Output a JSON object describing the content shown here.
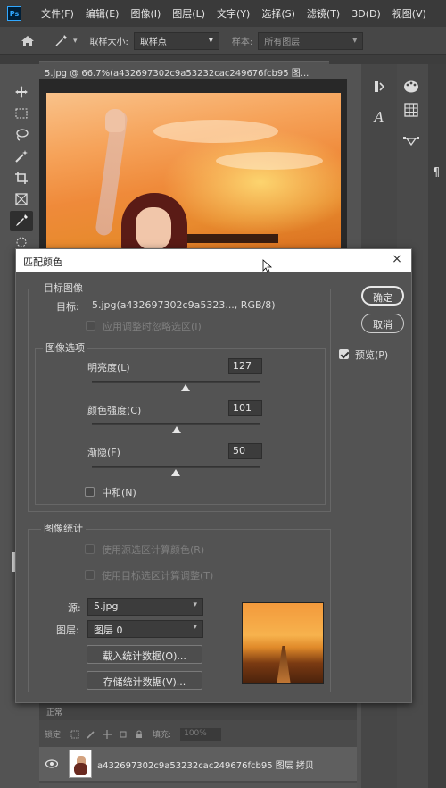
{
  "menubar": {
    "logo": "Ps",
    "items": [
      "文件(F)",
      "编辑(E)",
      "图像(I)",
      "图层(L)",
      "文字(Y)",
      "选择(S)",
      "滤镜(T)",
      "3D(D)",
      "视图(V)"
    ]
  },
  "options": {
    "sample_size_label": "取样大小:",
    "sample_size_value": "取样点",
    "sample_label": "样本:",
    "sample_value": "所有图层"
  },
  "document": {
    "tab_title": "5.jpg @ 66.7%(a432697302c9a53232cac249676fcb95 图..."
  },
  "layers_panel": {
    "mode": "正常",
    "lock_label": "锁定:",
    "fill_label": "填充:",
    "fill_value": "100%",
    "layer_name": "a432697302c9a53232cac249676fcb95 图层 拷贝"
  },
  "dialog": {
    "title": "匹配颜色",
    "close_label": "×",
    "target_group_title": "目标图像",
    "target_label": "目标:",
    "target_value": "5.jpg(a432697302c9a5323..., RGB/8)",
    "ignore_selection_label": "应用调整时忽略选区(I)",
    "image_options_title": "图像选项",
    "luminance_label": "明亮度(L)",
    "luminance_value": "127",
    "luminance_fraction": 0.56,
    "color_intensity_label": "颜色强度(C)",
    "color_intensity_value": "101",
    "color_intensity_fraction": 0.505,
    "fade_label": "渐隐(F)",
    "fade_value": "50",
    "fade_fraction": 0.5,
    "neutralize_label": "中和(N)",
    "image_stats_title": "图像统计",
    "use_selection_source_label": "使用源选区计算颜色(R)",
    "use_selection_target_label": "使用目标选区计算调整(T)",
    "source_label": "源:",
    "source_value": "5.jpg",
    "layer_label": "图层:",
    "layer_value": "图层 0",
    "load_stats_label": "载入统计数据(O)...",
    "save_stats_label": "存储统计数据(V)...",
    "ok_label": "确定",
    "cancel_label": "取消",
    "preview_label": "预览(P)",
    "preview_checked": true
  }
}
